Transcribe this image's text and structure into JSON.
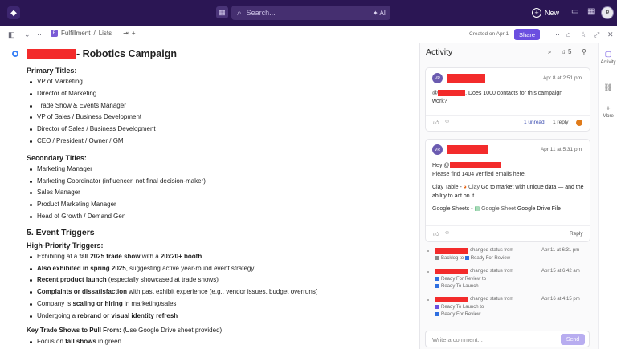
{
  "topbar": {
    "search_placeholder": "Search...",
    "ai_label": "AI",
    "new_label": "New"
  },
  "subbar": {
    "space": "Fulfillment",
    "separator": "/",
    "list": "Lists",
    "created": "Created on Apr 1",
    "share_label": "Share"
  },
  "doc": {
    "title_suffix": "- Robotics Campaign",
    "primary_heading": "Primary Titles:",
    "primary": [
      "VP of Marketing",
      "Director of Marketing",
      "Trade Show & Events Manager",
      "VP of Sales / Business Development",
      "Director of Sales / Business Development",
      "CEO / President / Owner / GM"
    ],
    "secondary_heading": "Secondary Titles:",
    "secondary": [
      "Marketing Manager",
      "Marketing Coordinator (influencer, not final decision-maker)",
      "Sales Manager",
      "Product Marketing Manager",
      "Head of Growth / Demand Gen"
    ],
    "section5": "5. Event Triggers",
    "high_heading": "High-Priority Triggers:",
    "triggers": [
      {
        "pre": "Exhibiting at a ",
        "b": "fall 2025 trade show",
        "mid": " with a ",
        "b2": "20x20+ booth",
        "post": ""
      },
      {
        "pre": "",
        "b": "Also exhibited in spring 2025",
        "mid": ", suggesting active year-round event strategy",
        "b2": "",
        "post": ""
      },
      {
        "pre": "",
        "b": "Recent product launch",
        "mid": " (especially showcased at trade shows)",
        "b2": "",
        "post": ""
      },
      {
        "pre": "",
        "b": "Complaints or dissatisfaction",
        "mid": " with past exhibit experience (e.g., vendor issues, budget overruns)",
        "b2": "",
        "post": ""
      },
      {
        "pre": "Company is ",
        "b": "scaling or hiring",
        "mid": " in marketing/sales",
        "b2": "",
        "post": ""
      },
      {
        "pre": "Undergoing a ",
        "b": "rebrand or visual identity refresh",
        "mid": "",
        "b2": "",
        "post": ""
      }
    ],
    "key_heading": "Key Trade Shows to Pull From:",
    "key_note": " (Use Google Drive sheet provided)",
    "focus_pre": "Focus on ",
    "focus_bold": "fall shows",
    "focus_post": " in green"
  },
  "activity": {
    "title": "Activity",
    "notif_count": "5",
    "comments": [
      {
        "avatar": "VR",
        "time": "Apr 8 at 2:51 pm",
        "text_pre": "@",
        "text_post": ". Does 1000 contacts for this campaign work?",
        "unread": "1 unread",
        "reply": "1 reply"
      },
      {
        "avatar": "VR",
        "time": "Apr 11 at 5:31 pm",
        "hey": "Hey @",
        "line1": "Please find 1404 verified emails here.",
        "clay_pre": "Clay Table - ",
        "clay_link": "Clay",
        "clay_post": " Go to market with unique data — and the ability to act on it",
        "gs_pre": "Google Sheets - ",
        "gs_link": "Google Sheet",
        "gs_post": " Google Drive File",
        "reply": "Reply"
      }
    ],
    "events": [
      {
        "action": "changed status from",
        "time": "Apr 11 at 6:31 pm",
        "from": "Backlog",
        "to": "Ready For Review",
        "from_color": "#8a8a8a",
        "to_color": "#2f6fe0"
      },
      {
        "action": "changed status from",
        "time": "Apr 15 at 6:42 am",
        "from": "Ready For Review",
        "to": "Ready To Launch",
        "from_color": "#2f6fe0",
        "to_color": "#2f6fe0"
      },
      {
        "action": "changed status from",
        "time": "Apr 16 at 4:15 pm",
        "from": "Ready To Launch",
        "to": "Ready For Review",
        "from_color": "#6b4fe0",
        "to_color": "#2f6fe0"
      }
    ],
    "to_word": "to",
    "comment_placeholder": "Write a comment...",
    "send_label": "Send"
  },
  "rail": {
    "activity": "Activity",
    "more": "More"
  }
}
